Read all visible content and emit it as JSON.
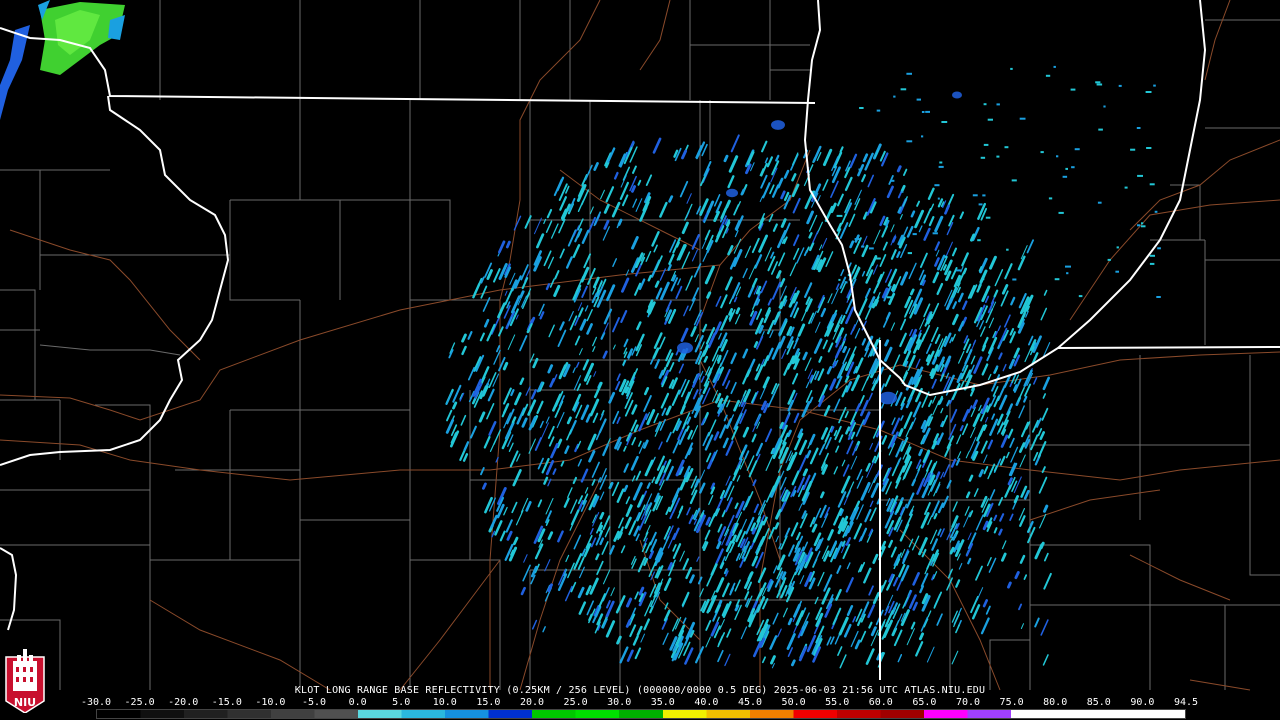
{
  "caption": {
    "text": "KLOT LONG RANGE BASE REFLECTIVITY (0.25KM / 256 LEVEL) (000000/0000 0.5 DEG) 2025-06-03 21:56 UTC  ATLAS.NIU.EDU"
  },
  "scale": {
    "labels": [
      "-30.0",
      "-25.0",
      "-20.0",
      "-15.0",
      "-10.0",
      "-5.0",
      "0.0",
      "5.0",
      "10.0",
      "15.0",
      "20.0",
      "25.0",
      "30.0",
      "35.0",
      "40.0",
      "45.0",
      "50.0",
      "55.0",
      "60.0",
      "65.0",
      "70.0",
      "75.0",
      "80.0",
      "85.0",
      "90.0",
      "94.5"
    ],
    "colors": [
      "#000000",
      "#101010",
      "#202020",
      "#303030",
      "#404040",
      "#505050",
      "#5ad8e0",
      "#2ab8e0",
      "#1590e0",
      "#0030d0",
      "#00c800",
      "#00e000",
      "#00b000",
      "#f0f000",
      "#f0c000",
      "#f08000",
      "#f00000",
      "#c00000",
      "#a00000",
      "#ff00ff",
      "#a040ff",
      "#ffffff",
      "#ffffff",
      "#ffffff",
      "#ffffff"
    ]
  },
  "logo": {
    "text": "NIU"
  },
  "colors": {
    "state_border": "#ffffff",
    "county_line": "#6a6a6a",
    "road": "#8a4a2a",
    "echo_light": "#22c7d6",
    "echo_mid": "#1aa0e0",
    "echo_blue": "#2060e0",
    "echo_green": "#40d030"
  }
}
